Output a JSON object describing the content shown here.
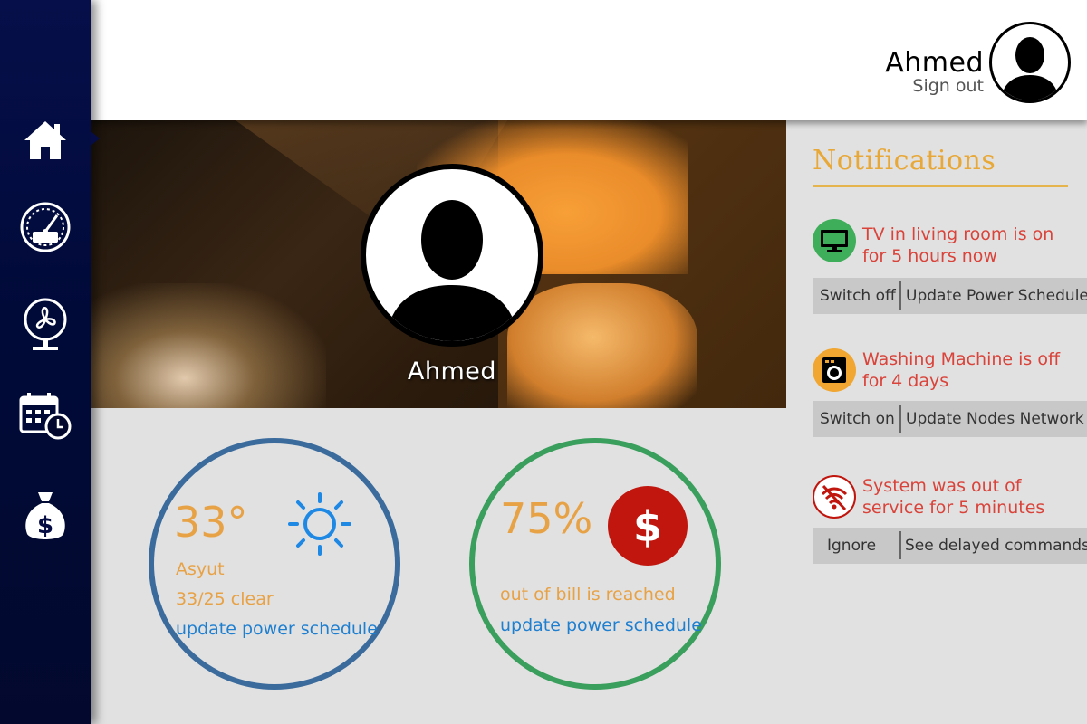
{
  "header": {
    "user_name": "Ahmed",
    "sign_out": "Sign out"
  },
  "sidebar": {
    "items": [
      {
        "icon": "home-icon"
      },
      {
        "icon": "meter-icon"
      },
      {
        "icon": "fan-icon"
      },
      {
        "icon": "calendar-clock-icon"
      },
      {
        "icon": "money-bag-icon"
      }
    ]
  },
  "hero": {
    "name": "Ahmed"
  },
  "weather": {
    "temp": "33°",
    "city": "Asyut",
    "summary": "33/25 clear",
    "link": "update power schedule",
    "icon": "sun-icon"
  },
  "bill": {
    "percent": "75%",
    "caption": "out of bill is reached",
    "link": "update power schedule",
    "icon": "dollar-icon"
  },
  "notifications": {
    "title": "Notifications",
    "items": [
      {
        "icon": "tv-icon",
        "icon_bg": "#3fae5a",
        "text": "TV in living room is on for 5 hours now",
        "action1": "Switch off",
        "action2": "Update Power Schedule"
      },
      {
        "icon": "washing-machine-icon",
        "icon_bg": "#f0a630",
        "text": "Washing Machine is off for 4 days",
        "action1": "Switch on",
        "action2": "Update Nodes Network"
      },
      {
        "icon": "wifi-off-icon",
        "icon_bg": "#ffffff",
        "text": "System was out of service for 5 minutes",
        "action1": "Ignore",
        "action2": "See delayed commands"
      }
    ]
  },
  "colors": {
    "sidebar": "#050c44",
    "accent_orange": "#e8a246",
    "link_blue": "#1e7fd0",
    "alert_red": "#d9433a",
    "weather_ring": "#3a6b9c",
    "bill_ring": "#3a9e5c"
  }
}
